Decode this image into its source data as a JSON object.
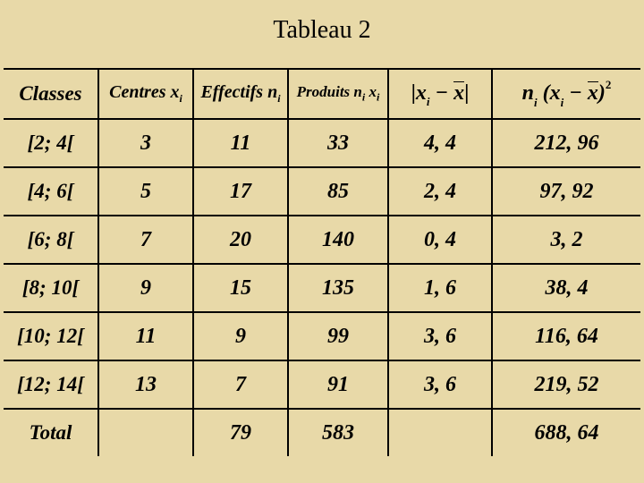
{
  "title": "Tableau 2",
  "headers": {
    "classes": "Classes",
    "centres_label": "Centres x",
    "centres_sub": "i",
    "effectifs_label": "Effectifs n",
    "effectifs_sub": "i",
    "produits_label": "Produits n",
    "produits_sub1": "i",
    "produits_mid": " x",
    "produits_sub2": "i"
  },
  "rows": {
    "0": {
      "class": "[2; 4[",
      "centre": "3",
      "effectif": "11",
      "produit": "33",
      "absdev": "4, 4",
      "nidev2": "212, 96"
    },
    "1": {
      "class": "[4; 6[",
      "centre": "5",
      "effectif": "17",
      "produit": "85",
      "absdev": "2, 4",
      "nidev2": "97, 92"
    },
    "2": {
      "class": "[6; 8[",
      "centre": "7",
      "effectif": "20",
      "produit": "140",
      "absdev": "0, 4",
      "nidev2": "3, 2"
    },
    "3": {
      "class": "[8; 10[",
      "centre": "9",
      "effectif": "15",
      "produit": "135",
      "absdev": "1, 6",
      "nidev2": "38, 4"
    },
    "4": {
      "class": "[10; 12[",
      "centre": "11",
      "effectif": "9",
      "produit": "99",
      "absdev": "3, 6",
      "nidev2": "116, 64"
    },
    "5": {
      "class": "[12; 14[",
      "centre": "13",
      "effectif": "7",
      "produit": "91",
      "absdev": "3, 6",
      "nidev2": "219, 52"
    }
  },
  "total": {
    "label": "Total",
    "effectif": "79",
    "produit": "583",
    "nidev2": "688, 64"
  },
  "chart_data": {
    "type": "table",
    "title": "Tableau 2",
    "columns": [
      "Classes",
      "Centres x_i",
      "Effectifs n_i",
      "Produits n_i x_i",
      "|x_i - x̄|",
      "n_i (x_i - x̄)^2"
    ],
    "rows": [
      {
        "Classes": "[2; 4[",
        "Centres x_i": 3,
        "Effectifs n_i": 11,
        "Produits n_i x_i": 33,
        "|x_i - x̄|": 4.4,
        "n_i (x_i - x̄)^2": 212.96
      },
      {
        "Classes": "[4; 6[",
        "Centres x_i": 5,
        "Effectifs n_i": 17,
        "Produits n_i x_i": 85,
        "|x_i - x̄|": 2.4,
        "n_i (x_i - x̄)^2": 97.92
      },
      {
        "Classes": "[6; 8[",
        "Centres x_i": 7,
        "Effectifs n_i": 20,
        "Produits n_i x_i": 140,
        "|x_i - x̄|": 0.4,
        "n_i (x_i - x̄)^2": 3.2
      },
      {
        "Classes": "[8; 10[",
        "Centres x_i": 9,
        "Effectifs n_i": 15,
        "Produits n_i x_i": 135,
        "|x_i - x̄|": 1.6,
        "n_i (x_i - x̄)^2": 38.4
      },
      {
        "Classes": "[10; 12[",
        "Centres x_i": 11,
        "Effectifs n_i": 9,
        "Produits n_i x_i": 99,
        "|x_i - x̄|": 3.6,
        "n_i (x_i - x̄)^2": 116.64
      },
      {
        "Classes": "[12; 14[",
        "Centres x_i": 13,
        "Effectifs n_i": 7,
        "Produits n_i x_i": 91,
        "|x_i - x̄|": 3.6,
        "n_i (x_i - x̄)^2": 219.52
      }
    ],
    "totals": {
      "Effectifs n_i": 79,
      "Produits n_i x_i": 583,
      "n_i (x_i - x̄)^2": 688.64
    }
  }
}
